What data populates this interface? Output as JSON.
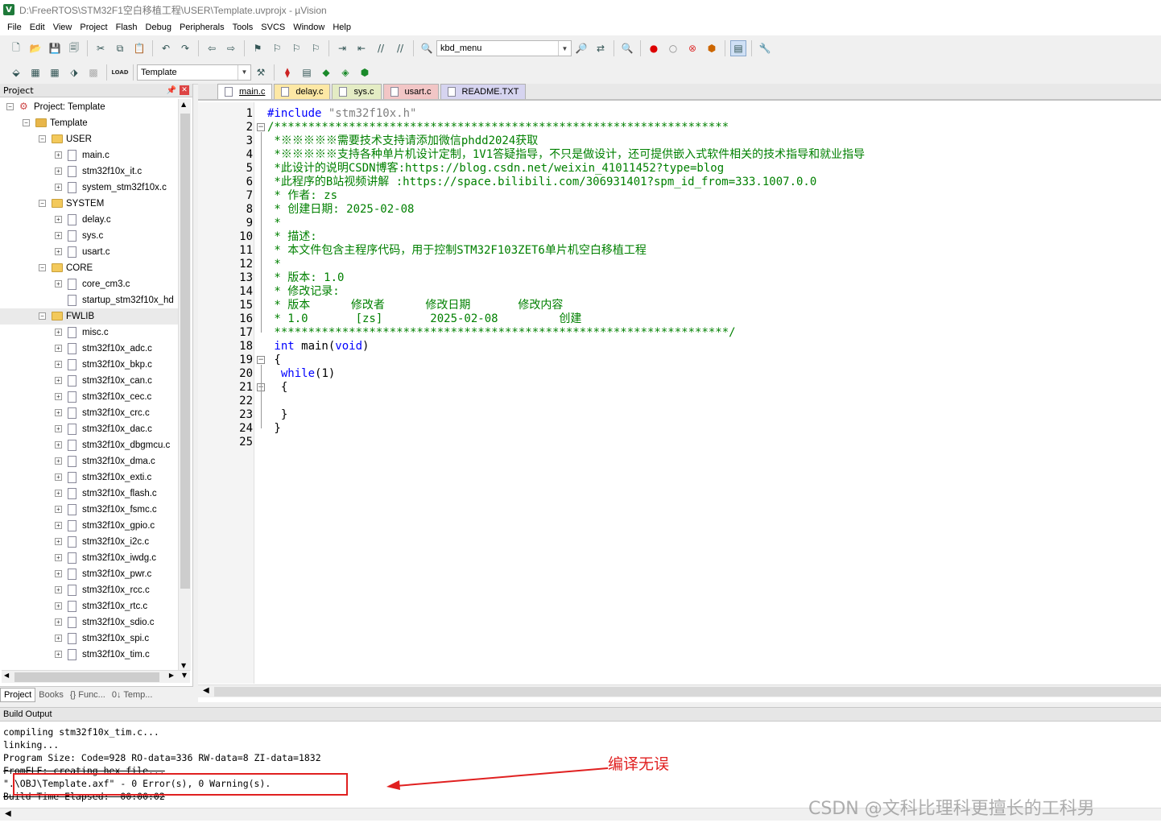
{
  "window": {
    "title": "D:\\FreeRTOS\\STM32F1空白移植工程\\USER\\Template.uvprojx - µVision",
    "logo": "V"
  },
  "menu": [
    "File",
    "Edit",
    "View",
    "Project",
    "Flash",
    "Debug",
    "Peripherals",
    "Tools",
    "SVCS",
    "Window",
    "Help"
  ],
  "toolbar": {
    "find_combo": "kbd_menu",
    "target_combo": "Template",
    "load_label": "LOAD"
  },
  "project_panel": {
    "header": "Project",
    "tree": [
      {
        "label": "Project: Template",
        "level": 0,
        "kind": "project",
        "exp": "-"
      },
      {
        "label": "Template",
        "level": 1,
        "kind": "target",
        "exp": "-"
      },
      {
        "label": "USER",
        "level": 2,
        "kind": "folder",
        "exp": "-"
      },
      {
        "label": "main.c",
        "level": 3,
        "kind": "file",
        "exp": "+"
      },
      {
        "label": "stm32f10x_it.c",
        "level": 3,
        "kind": "file",
        "exp": "+"
      },
      {
        "label": "system_stm32f10x.c",
        "level": 3,
        "kind": "file",
        "exp": "+"
      },
      {
        "label": "SYSTEM",
        "level": 2,
        "kind": "folder",
        "exp": "-"
      },
      {
        "label": "delay.c",
        "level": 3,
        "kind": "file",
        "exp": "+"
      },
      {
        "label": "sys.c",
        "level": 3,
        "kind": "file",
        "exp": "+"
      },
      {
        "label": "usart.c",
        "level": 3,
        "kind": "file",
        "exp": "+"
      },
      {
        "label": "CORE",
        "level": 2,
        "kind": "folder",
        "exp": "-"
      },
      {
        "label": "core_cm3.c",
        "level": 3,
        "kind": "file",
        "exp": "+"
      },
      {
        "label": "startup_stm32f10x_hd",
        "level": 3,
        "kind": "file",
        "exp": ""
      },
      {
        "label": "FWLIB",
        "level": 2,
        "kind": "folder",
        "exp": "-",
        "selected": true
      },
      {
        "label": "misc.c",
        "level": 3,
        "kind": "file",
        "exp": "+"
      },
      {
        "label": "stm32f10x_adc.c",
        "level": 3,
        "kind": "file",
        "exp": "+"
      },
      {
        "label": "stm32f10x_bkp.c",
        "level": 3,
        "kind": "file",
        "exp": "+"
      },
      {
        "label": "stm32f10x_can.c",
        "level": 3,
        "kind": "file",
        "exp": "+"
      },
      {
        "label": "stm32f10x_cec.c",
        "level": 3,
        "kind": "file",
        "exp": "+"
      },
      {
        "label": "stm32f10x_crc.c",
        "level": 3,
        "kind": "file",
        "exp": "+"
      },
      {
        "label": "stm32f10x_dac.c",
        "level": 3,
        "kind": "file",
        "exp": "+"
      },
      {
        "label": "stm32f10x_dbgmcu.c",
        "level": 3,
        "kind": "file",
        "exp": "+"
      },
      {
        "label": "stm32f10x_dma.c",
        "level": 3,
        "kind": "file",
        "exp": "+"
      },
      {
        "label": "stm32f10x_exti.c",
        "level": 3,
        "kind": "file",
        "exp": "+"
      },
      {
        "label": "stm32f10x_flash.c",
        "level": 3,
        "kind": "file",
        "exp": "+"
      },
      {
        "label": "stm32f10x_fsmc.c",
        "level": 3,
        "kind": "file",
        "exp": "+"
      },
      {
        "label": "stm32f10x_gpio.c",
        "level": 3,
        "kind": "file",
        "exp": "+"
      },
      {
        "label": "stm32f10x_i2c.c",
        "level": 3,
        "kind": "file",
        "exp": "+"
      },
      {
        "label": "stm32f10x_iwdg.c",
        "level": 3,
        "kind": "file",
        "exp": "+"
      },
      {
        "label": "stm32f10x_pwr.c",
        "level": 3,
        "kind": "file",
        "exp": "+"
      },
      {
        "label": "stm32f10x_rcc.c",
        "level": 3,
        "kind": "file",
        "exp": "+"
      },
      {
        "label": "stm32f10x_rtc.c",
        "level": 3,
        "kind": "file",
        "exp": "+"
      },
      {
        "label": "stm32f10x_sdio.c",
        "level": 3,
        "kind": "file",
        "exp": "+"
      },
      {
        "label": "stm32f10x_spi.c",
        "level": 3,
        "kind": "file",
        "exp": "+"
      },
      {
        "label": "stm32f10x_tim.c",
        "level": 3,
        "kind": "file",
        "exp": "+"
      }
    ],
    "bottom_tabs": [
      "Project",
      "Books",
      "{} Func...",
      "0↓ Temp..."
    ]
  },
  "editor": {
    "tabs": [
      {
        "label": "main.c",
        "cls": "t-main"
      },
      {
        "label": "delay.c",
        "cls": "t-delay"
      },
      {
        "label": "sys.c",
        "cls": "t-sys"
      },
      {
        "label": "usart.c",
        "cls": "t-usart"
      },
      {
        "label": "README.TXT",
        "cls": "t-readme"
      }
    ],
    "line_numbers": [
      "1",
      "2",
      "3",
      "4",
      "5",
      "6",
      "7",
      "8",
      "9",
      "10",
      "11",
      "12",
      "13",
      "14",
      "15",
      "16",
      "17",
      "18",
      "19",
      "20",
      "21",
      "22",
      "23",
      "24",
      "25"
    ],
    "lines": [
      [
        {
          "c": "c-pre",
          "t": "#include "
        },
        {
          "c": "c-str",
          "t": "\"stm32f10x.h\""
        }
      ],
      [
        {
          "c": "c-com",
          "t": "/*******************************************************************"
        }
      ],
      [
        {
          "c": "c-com",
          "t": " *※※※※※需要技术支持请添加微信phdd2024获取"
        }
      ],
      [
        {
          "c": "c-com",
          "t": " *※※※※※支持各种单片机设计定制，1V1答疑指导，不只是做设计，还可提供嵌入式软件相关的技术指导和就业指导"
        }
      ],
      [
        {
          "c": "c-com",
          "t": " *此设计的说明CSDN博客:https://blog.csdn.net/weixin_41011452?type=blog"
        }
      ],
      [
        {
          "c": "c-com",
          "t": " *此程序的B站视频讲解 :https://space.bilibili.com/306931401?spm_id_from=333.1007.0.0"
        }
      ],
      [
        {
          "c": "c-com",
          "t": " * 作者: zs"
        }
      ],
      [
        {
          "c": "c-com",
          "t": " * 创建日期: 2025-02-08"
        }
      ],
      [
        {
          "c": "c-com",
          "t": " *"
        }
      ],
      [
        {
          "c": "c-com",
          "t": " * 描述:"
        }
      ],
      [
        {
          "c": "c-com",
          "t": " * 本文件包含主程序代码，用于控制STM32F103ZET6单片机空白移植工程"
        }
      ],
      [
        {
          "c": "c-com",
          "t": " *"
        }
      ],
      [
        {
          "c": "c-com",
          "t": " * 版本: 1.0"
        }
      ],
      [
        {
          "c": "c-com",
          "t": " * 修改记录:"
        }
      ],
      [
        {
          "c": "c-com",
          "t": " * 版本      修改者      修改日期       修改内容"
        }
      ],
      [
        {
          "c": "c-com",
          "t": " * 1.0       [zs]       2025-02-08         创建"
        }
      ],
      [
        {
          "c": "c-com",
          "t": " *******************************************************************/"
        }
      ],
      [
        {
          "c": "c-kw",
          "t": " int"
        },
        {
          "c": "c-tx",
          "t": " main("
        },
        {
          "c": "c-kw",
          "t": "void"
        },
        {
          "c": "c-tx",
          "t": ")"
        }
      ],
      [
        {
          "c": "c-tx",
          "t": " {"
        }
      ],
      [
        {
          "c": "c-kw",
          "t": "  while"
        },
        {
          "c": "c-tx",
          "t": "(1)"
        }
      ],
      [
        {
          "c": "c-tx",
          "t": "  {"
        }
      ],
      [
        {
          "c": "c-tx",
          "t": ""
        }
      ],
      [
        {
          "c": "c-tx",
          "t": "  }"
        }
      ],
      [
        {
          "c": "c-tx",
          "t": " }"
        }
      ],
      [
        {
          "c": "c-tx",
          "t": ""
        }
      ]
    ]
  },
  "build_output": {
    "header": "Build Output",
    "lines": [
      "compiling stm32f10x_tim.c...",
      "linking...",
      "Program Size: Code=928 RO-data=336 RW-data=8 ZI-data=1832",
      "FromELF: creating hex file...",
      "\".\\OBJ\\Template.axf\" - 0 Error(s), 0 Warning(s).",
      "Build Time Elapsed:  00:00:02"
    ]
  },
  "annotation": {
    "text": "编译无误",
    "color": "#e02020"
  },
  "watermark": "CSDN @文科比理科更擅长的工科男"
}
